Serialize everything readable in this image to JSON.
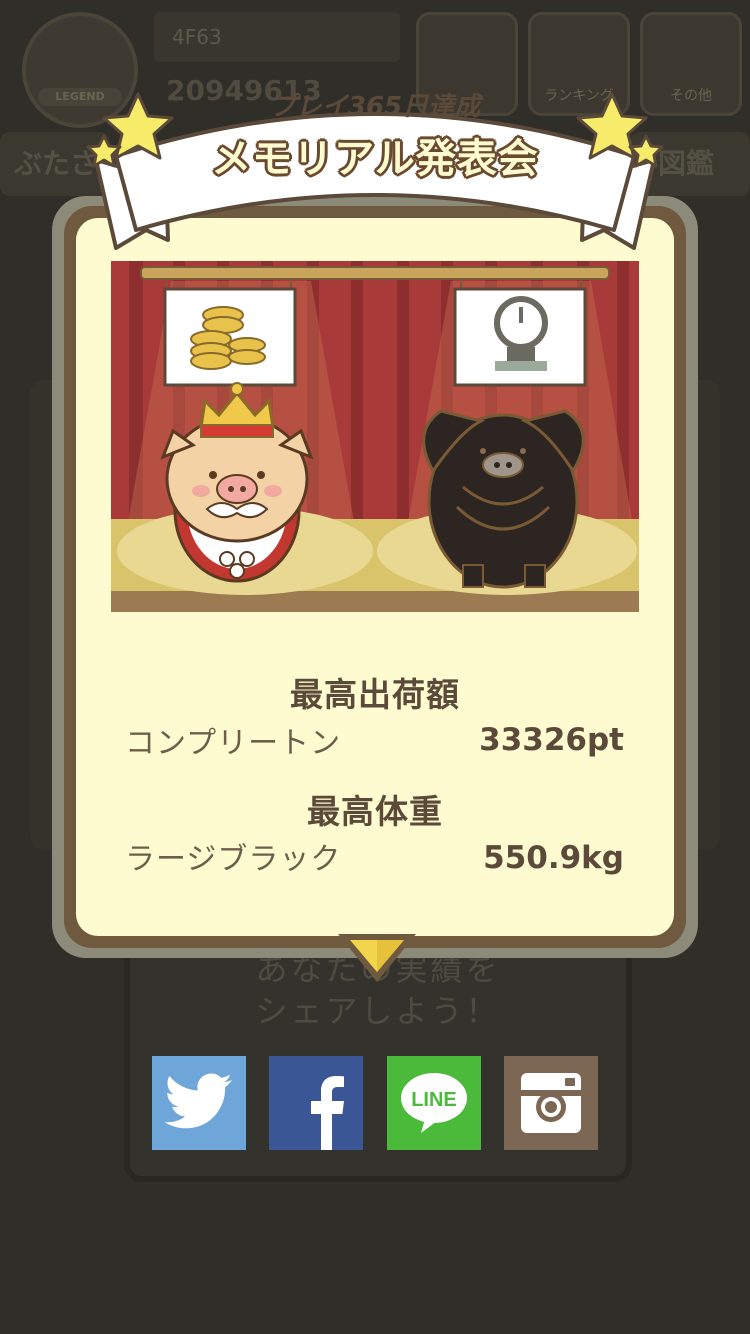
{
  "background": {
    "player_id": "4F63",
    "money": "20949613",
    "badge_label": "LEGEND",
    "rank_button": "ランキング",
    "settings_button": "その他",
    "left_tab": "ぶたさ",
    "right_tab": "図鑑",
    "share_prompt_line1": "あなたの実績を",
    "share_prompt_line2": "シェアしよう！"
  },
  "banner": {
    "subtitle": "プレイ365日達成",
    "title": "メモリアル発表会"
  },
  "stats": {
    "max_shipment": {
      "heading": "最高出荷額",
      "name": "コンプリートン",
      "value": "33326pt"
    },
    "max_weight": {
      "heading": "最高体重",
      "name": "ラージブラック",
      "value": "550.9kg"
    }
  },
  "share": {
    "twitter_icon": "twitter-icon",
    "facebook_icon": "facebook-icon",
    "line_label": "LINE",
    "instagram_icon": "instagram-icon"
  },
  "colors": {
    "card_bg": "#fffbd0",
    "card_border": "#6f5a3f",
    "twitter": "#6fa6d9",
    "facebook": "#3b5694",
    "line": "#4bb93a",
    "instagram": "#7b6754"
  }
}
